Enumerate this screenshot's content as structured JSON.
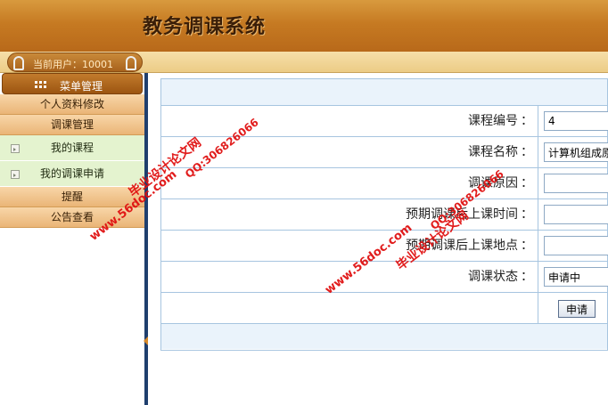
{
  "header": {
    "title": "教务调课系统"
  },
  "userbar": {
    "current_user": "当前用户：10001"
  },
  "sidebar": {
    "menu_head": "菜单管理",
    "items": [
      {
        "label": "个人资料修改",
        "type": "category"
      },
      {
        "label": "调课管理",
        "type": "category"
      },
      {
        "label": "我的课程",
        "type": "sub"
      },
      {
        "label": "我的调课申请",
        "type": "sub"
      },
      {
        "label": "提醒",
        "type": "category"
      },
      {
        "label": "公告查看",
        "type": "category"
      }
    ]
  },
  "form": {
    "rows": [
      {
        "label": "课程编号",
        "value": "4"
      },
      {
        "label": "课程名称",
        "value": "计算机组成原"
      },
      {
        "label": "调课原因",
        "value": ""
      },
      {
        "label": "预期调课后上课时间",
        "value": ""
      },
      {
        "label": "预期调课后上课地点",
        "value": ""
      },
      {
        "label": "调课状态",
        "value": "申请中"
      }
    ],
    "colon": "：",
    "submit_label": "申请"
  },
  "watermarks": {
    "line1": "毕业设计论文网",
    "line2": "www.56doc.com",
    "line3": "QQ:306826066"
  },
  "colors": {
    "header": "#c67a22",
    "accent": "#9c5511",
    "watermark": "#e01010",
    "sub_bg": "#e4f3cf"
  }
}
